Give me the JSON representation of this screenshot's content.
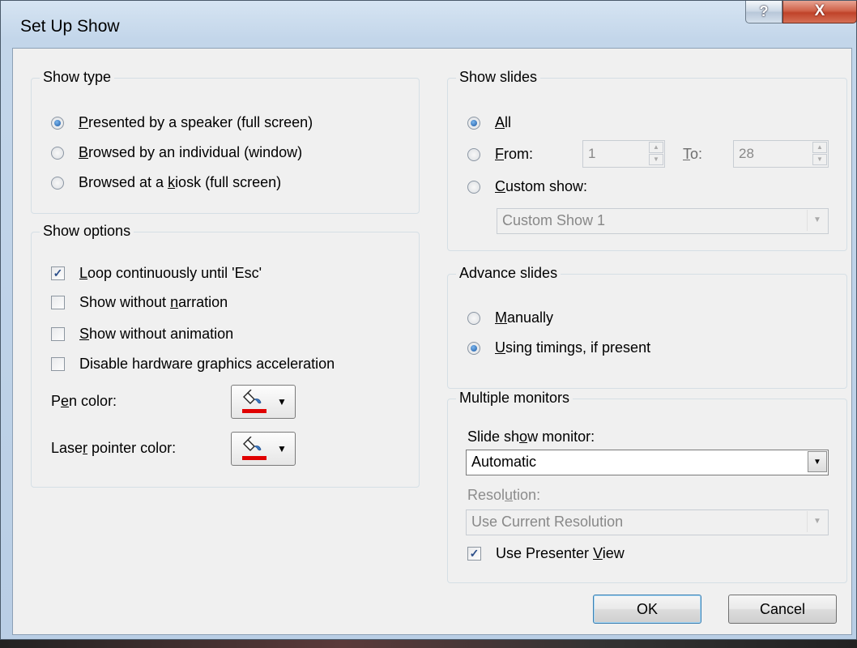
{
  "window": {
    "title": "Set Up Show",
    "help_label": "?",
    "close_label": "X"
  },
  "show_type": {
    "legend": "Show type",
    "options": [
      {
        "pre": "",
        "key": "P",
        "post": "resented by a speaker (full screen)",
        "selected": true
      },
      {
        "pre": "",
        "key": "B",
        "post": "rowsed by an individual (window)",
        "selected": false
      },
      {
        "pre": "Browsed at a ",
        "key": "k",
        "post": "iosk (full screen)",
        "selected": false
      }
    ]
  },
  "show_options": {
    "legend": "Show options",
    "checks": [
      {
        "pre": "",
        "key": "L",
        "post": "oop continuously until 'Esc'",
        "checked": true
      },
      {
        "pre": "Show without ",
        "key": "n",
        "post": "arration",
        "checked": false
      },
      {
        "pre": "",
        "key": "S",
        "post": "how without animation",
        "checked": false
      },
      {
        "pre": "Disable hardware ",
        "key": "g",
        "post": "raphics acceleration",
        "checked": false
      }
    ],
    "pen_color": {
      "pre": "P",
      "key": "e",
      "post": "n color:",
      "color": "#e00000"
    },
    "laser_color": {
      "pre": "Lase",
      "key": "r",
      "post": " pointer color:",
      "color": "#e00000"
    }
  },
  "show_slides": {
    "legend": "Show slides",
    "all": {
      "key": "A",
      "post": "ll",
      "selected": true
    },
    "from": {
      "key": "F",
      "post": "rom:",
      "selected": false,
      "from_value": "1",
      "to_key": "T",
      "to_post": "o:",
      "to_value": "28"
    },
    "custom": {
      "key": "C",
      "post": "ustom show:",
      "selected": false,
      "value": "Custom Show 1"
    }
  },
  "advance_slides": {
    "legend": "Advance slides",
    "manually": {
      "key": "M",
      "post": "anually",
      "selected": false
    },
    "timings": {
      "key": "U",
      "post": "sing timings, if present",
      "selected": true
    }
  },
  "multiple_monitors": {
    "legend": "Multiple monitors",
    "monitor_label": {
      "pre": "Slide sh",
      "key": "o",
      "post": "w monitor:"
    },
    "monitor_value": "Automatic",
    "resolution_label": {
      "pre": "Resol",
      "key": "u",
      "post": "tion:"
    },
    "resolution_value": "Use Current Resolution",
    "presenter_view": {
      "pre": "Use Presenter ",
      "key": "V",
      "post": "iew",
      "checked": true
    }
  },
  "buttons": {
    "ok": "OK",
    "cancel": "Cancel"
  }
}
